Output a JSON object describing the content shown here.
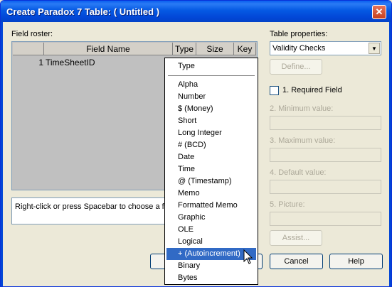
{
  "window": {
    "title": "Create Paradox 7 Table:  ( Untitled )"
  },
  "left": {
    "field_roster_label": "Field roster:",
    "columns": [
      "Field Name",
      "Type",
      "Size",
      "Key"
    ],
    "rows": [
      {
        "num": "1",
        "field_name": "TimeSheetID"
      }
    ],
    "hint": "Right-click or press Spacebar to choose a fie"
  },
  "right": {
    "table_properties_label": "Table properties:",
    "table_properties_value": "Validity Checks",
    "define_button": "Define...",
    "required_field": "1. Required Field",
    "minimum_value": "2. Minimum value:",
    "maximum_value": "3. Maximum value:",
    "default_value": "4. Default value:",
    "picture": "5. Picture:",
    "assist_button": "Assist...",
    "cancel_button": "Cancel",
    "help_button": "Help"
  },
  "type_menu": {
    "header": "Type",
    "items": [
      "Alpha",
      "Number",
      "$ (Money)",
      "Short",
      "Long Integer",
      "# (BCD)",
      "Date",
      "Time",
      "@ (Timestamp)",
      "Memo",
      "Formatted Memo",
      "Graphic",
      "OLE",
      "Logical",
      "+ (Autoincrement)",
      "Binary",
      "Bytes"
    ],
    "selected": "+ (Autoincrement)"
  }
}
